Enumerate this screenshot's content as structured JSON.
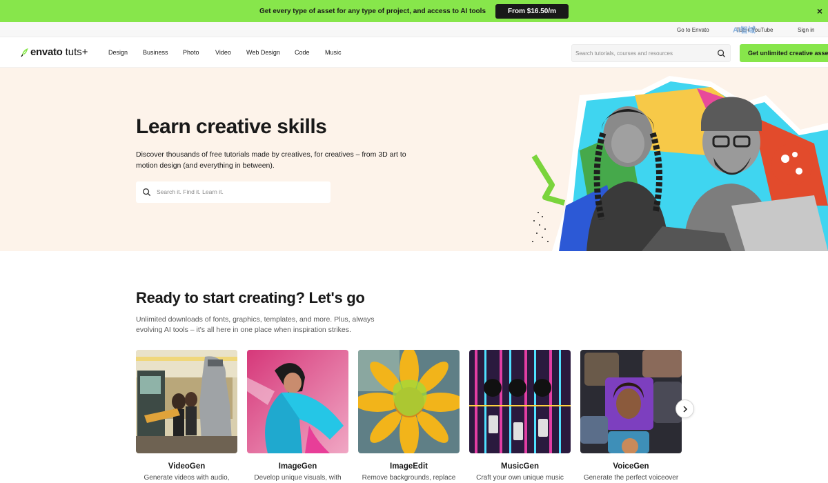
{
  "promo": {
    "text": "Get every type of asset for any type of project, and access to AI tools",
    "button": "From $16.50/m",
    "close": "×"
  },
  "utility": {
    "go_to_envato": "Go to Envato",
    "tutsplus": "Tuts+ YouTube",
    "sign_in": "Sign in"
  },
  "nav": {
    "logo_brand": "envato",
    "logo_product": "tuts+",
    "links": [
      "Design",
      "Business",
      "Photo",
      "Video",
      "Web Design",
      "Code",
      "Music"
    ],
    "search_placeholder": "Search tutorials, courses and resources",
    "cta": "Get unlimited creative assets"
  },
  "hero": {
    "title": "Learn creative skills",
    "description": "Discover thousands of free tutorials made by creatives, for creatives – from 3D art to motion design (and everything in between).",
    "search_placeholder": "Search it. Find it. Learn it."
  },
  "section": {
    "title": "Ready to start creating? Let's go",
    "description": "Unlimited downloads of fonts, graphics, templates, and more. Plus, always evolving AI tools – it's all here in one place when inspiration strikes."
  },
  "cards": [
    {
      "name": "VideoGen",
      "desc": "Generate videos with audio,"
    },
    {
      "name": "ImageGen",
      "desc": "Develop unique visuals, with"
    },
    {
      "name": "ImageEdit",
      "desc": "Remove backgrounds, replace"
    },
    {
      "name": "MusicGen",
      "desc": "Craft your own unique music"
    },
    {
      "name": "VoiceGen",
      "desc": "Generate the perfect voiceover"
    }
  ],
  "colors": {
    "brand_green": "#87e64b",
    "hero_bg": "#fdf3ea",
    "text_dark": "#191919"
  },
  "icons": [
    "envato-leaf-icon",
    "search-icon",
    "close-icon",
    "chevron-right-icon"
  ]
}
